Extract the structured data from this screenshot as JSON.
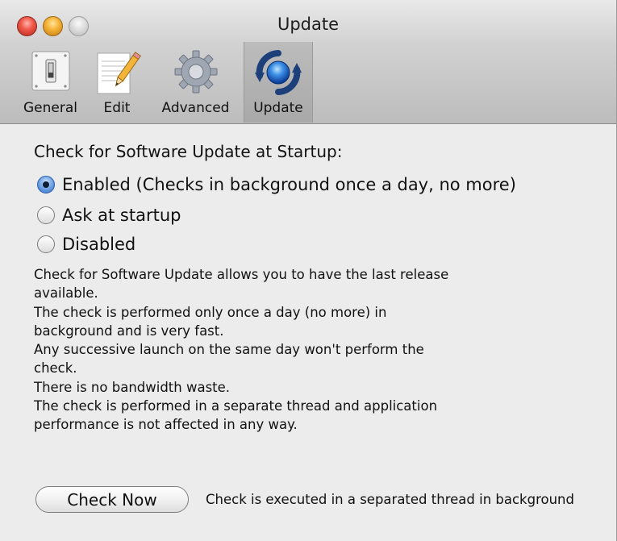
{
  "window": {
    "title": "Update"
  },
  "toolbar": {
    "items": [
      {
        "label": "General",
        "icon": "light-switch-icon"
      },
      {
        "label": "Edit",
        "icon": "notepad-pencil-icon"
      },
      {
        "label": "Advanced",
        "icon": "gear-icon"
      },
      {
        "label": "Update",
        "icon": "refresh-arrows-icon",
        "selected": true
      }
    ]
  },
  "update_settings": {
    "heading": "Check for Software Update at Startup:",
    "options": [
      {
        "label": "Enabled (Checks in background once a day, no more)",
        "selected": true
      },
      {
        "label": "Ask at startup",
        "selected": false
      },
      {
        "label": "Disabled",
        "selected": false
      }
    ],
    "description_lines": [
      "Check for Software Update allows you to have the last release",
      "available.",
      "The check is performed only once a day (no more) in",
      "background and is very fast.",
      "Any successive launch on the same day won't perform the",
      "check.",
      "There is no bandwidth waste.",
      "The check is performed in a separate thread and application",
      "performance is not affected in any way."
    ],
    "check_button_label": "Check Now",
    "check_note": "Check is executed in a separated thread in background"
  },
  "colors": {
    "accent_blue": "#2e6ac4",
    "close_red": "#f0584a",
    "minimize_yellow": "#f7b43b",
    "window_bg": "#ececec"
  }
}
